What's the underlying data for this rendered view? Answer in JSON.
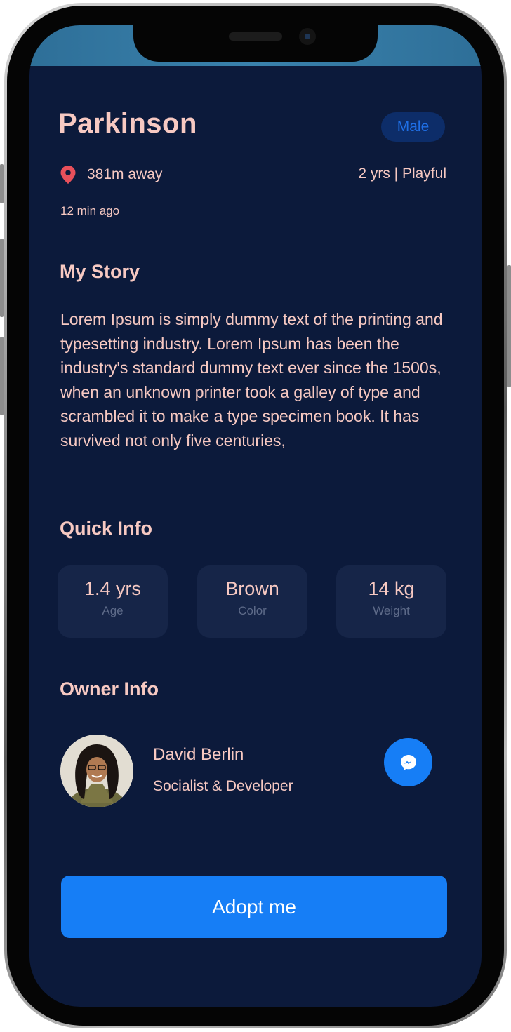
{
  "pet": {
    "name": "Parkinson",
    "gender": "Male",
    "distance": "381m away",
    "age_mood": "2 yrs | Playful",
    "posted": "12 min ago"
  },
  "story": {
    "title": "My Story",
    "text": "Lorem Ipsum is simply dummy text of the printing and typesetting industry. Lorem Ipsum has been the industry's standard dummy text ever since the 1500s, when an unknown printer took a galley of type and scrambled it to make a type specimen book. It has survived not only five centuries,"
  },
  "quick_info": {
    "title": "Quick Info",
    "items": [
      {
        "value": "1.4 yrs",
        "label": "Age"
      },
      {
        "value": "Brown",
        "label": "Color"
      },
      {
        "value": "14 kg",
        "label": "Weight"
      }
    ]
  },
  "owner": {
    "title": "Owner Info",
    "name": "David Berlin",
    "role": "Socialist & Developer",
    "message_icon": "messenger-icon"
  },
  "actions": {
    "adopt_label": "Adopt me"
  },
  "colors": {
    "background": "#0c1a3b",
    "accent": "#167ef6",
    "text_pink": "#f7c9c2",
    "card": "#162548",
    "badge_bg": "#0d2d69",
    "muted": "#5e6b89",
    "pin": "#e8505b"
  }
}
